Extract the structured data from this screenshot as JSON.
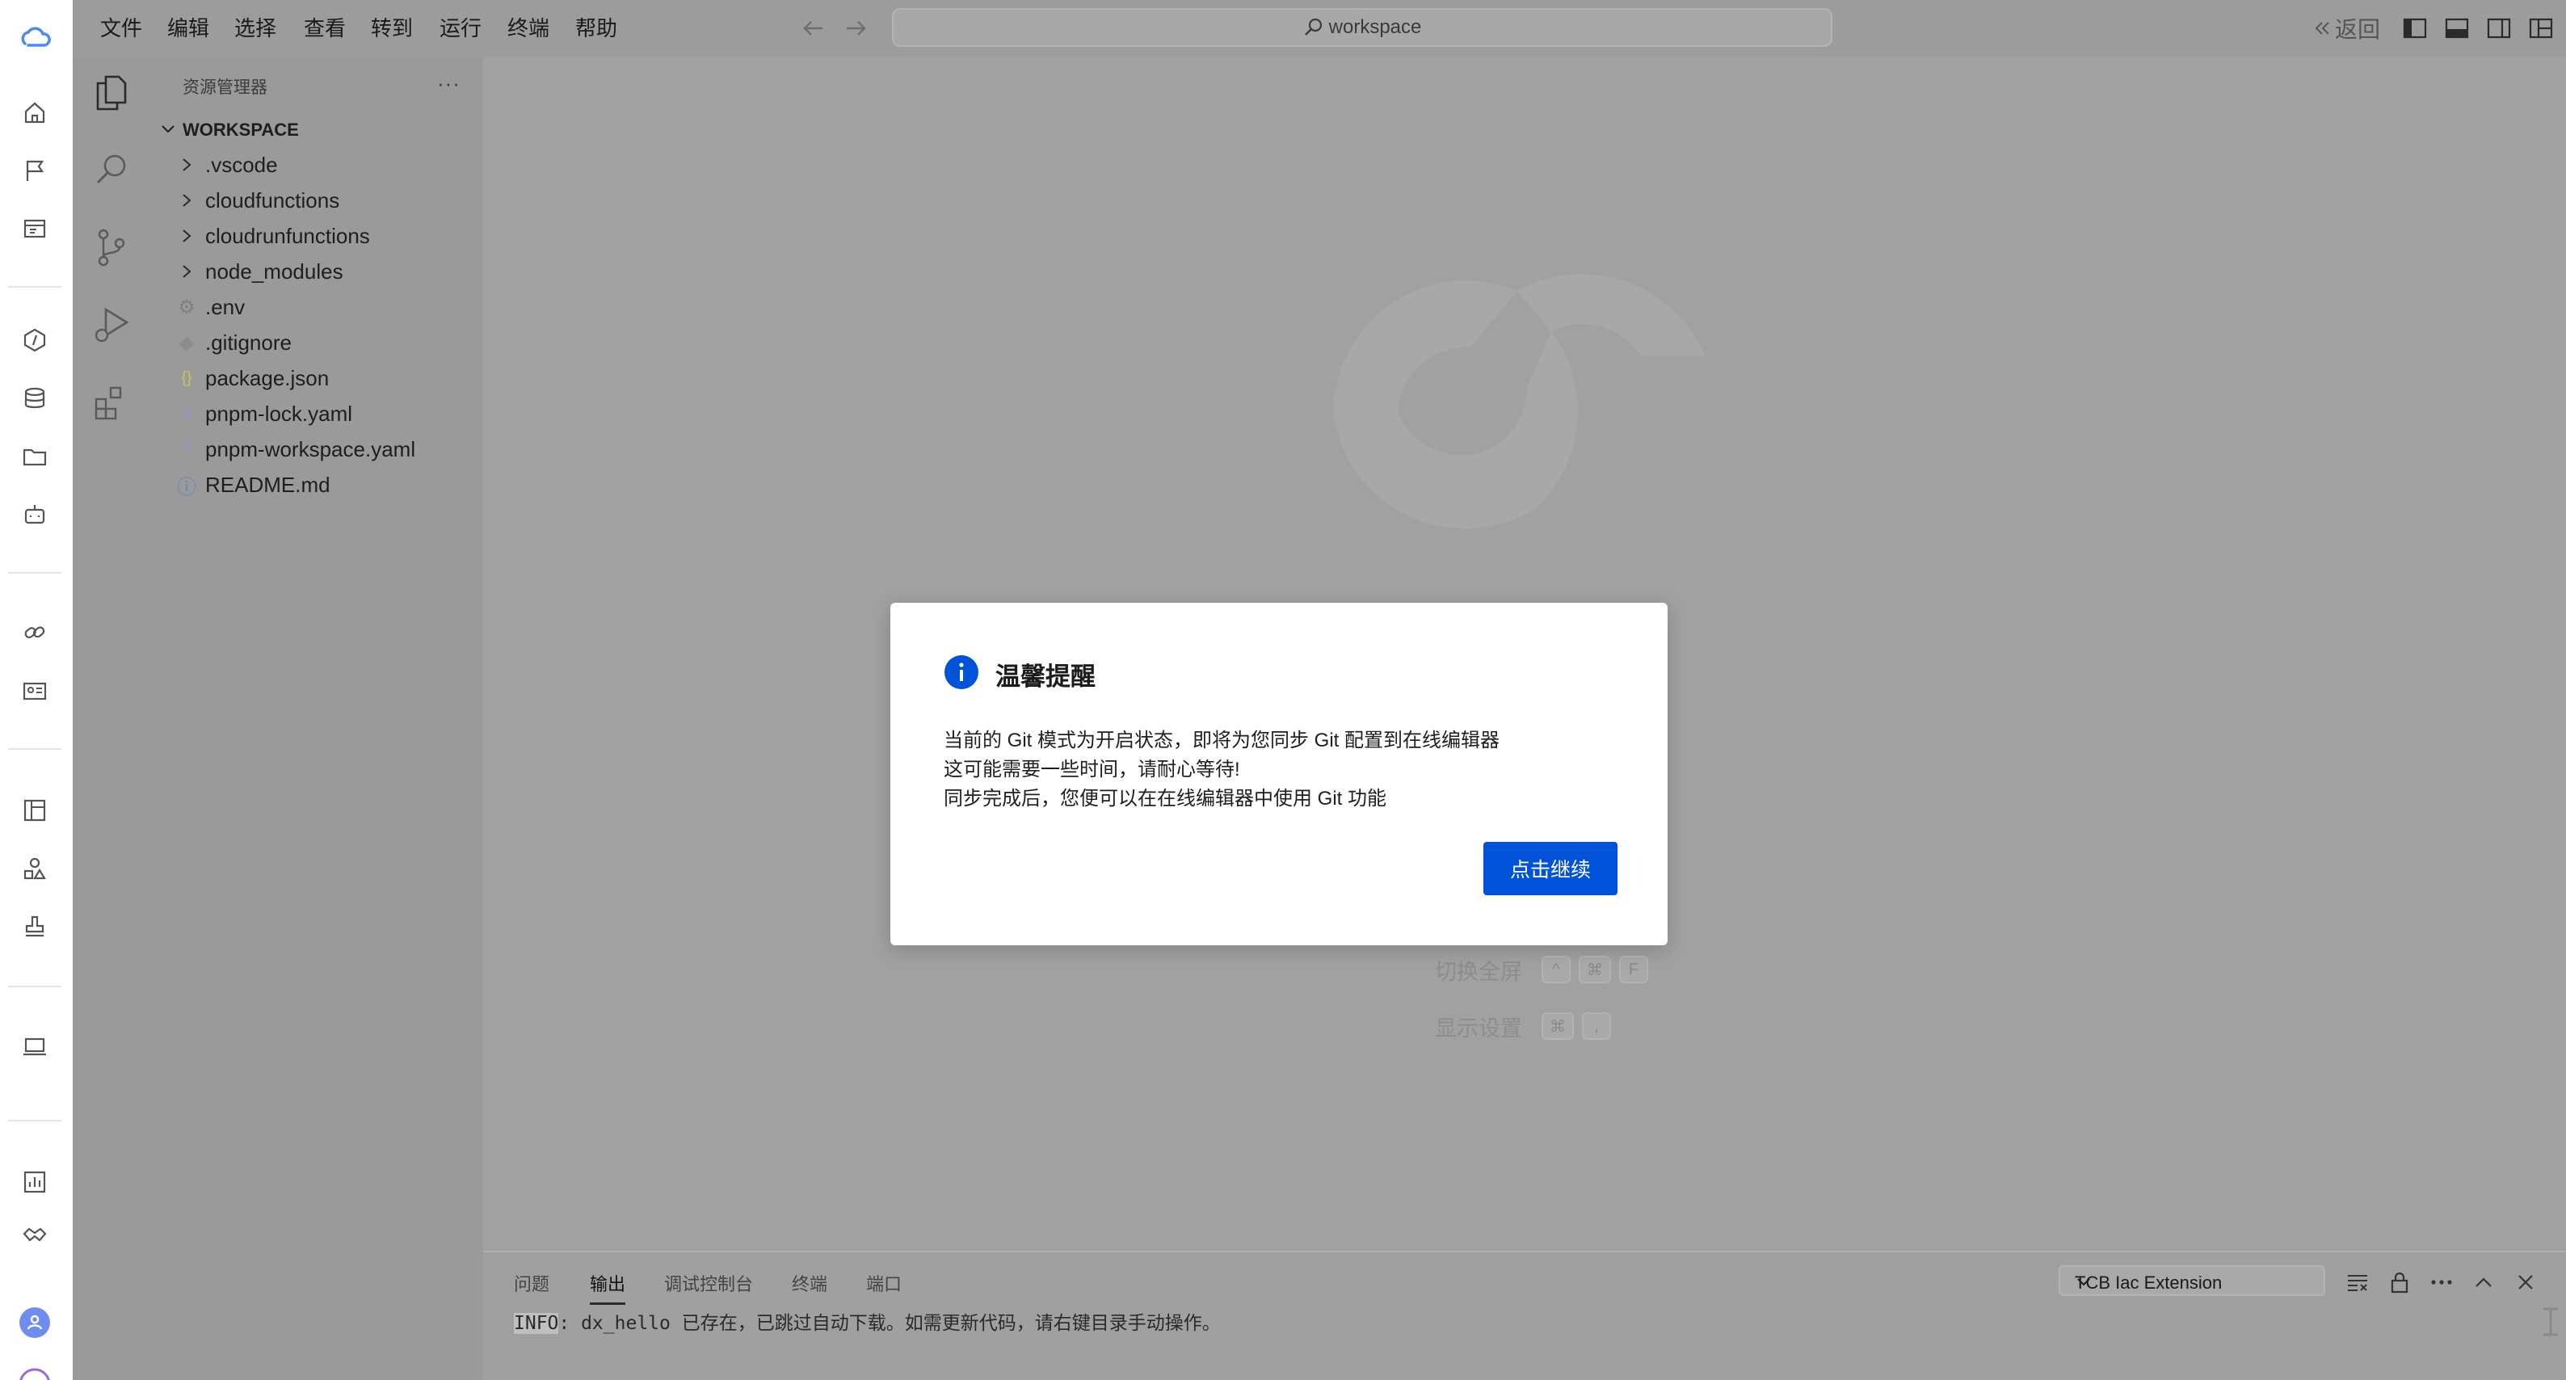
{
  "menu": [
    "文件",
    "编辑",
    "选择",
    "查看",
    "转到",
    "运行",
    "终端",
    "帮助"
  ],
  "search": {
    "text": "workspace"
  },
  "titlebar_right": {
    "back_label": "返回"
  },
  "explorer": {
    "title": "资源管理器",
    "more": "···",
    "workspace_label": "WORKSPACE",
    "items": [
      {
        "name": ".vscode",
        "type": "folder",
        "icon": "chevron-right-icon"
      },
      {
        "name": "cloudfunctions",
        "type": "folder",
        "icon": "chevron-right-icon"
      },
      {
        "name": "cloudrunfunctions",
        "type": "folder",
        "icon": "chevron-right-icon"
      },
      {
        "name": "node_modules",
        "type": "folder",
        "icon": "chevron-right-icon"
      },
      {
        "name": ".env",
        "type": "file",
        "icon": "gear-file-icon",
        "glyph": "⚙",
        "color": "#808080"
      },
      {
        "name": ".gitignore",
        "type": "file",
        "icon": "git-file-icon",
        "glyph": "◆",
        "color": "#8c8c8c"
      },
      {
        "name": "package.json",
        "type": "file",
        "icon": "json-file-icon",
        "glyph": "{}",
        "color": "#c9c25a"
      },
      {
        "name": "pnpm-lock.yaml",
        "type": "file",
        "icon": "yaml-file-icon",
        "glyph": "!",
        "color": "#9b8fd6"
      },
      {
        "name": "pnpm-workspace.yaml",
        "type": "file",
        "icon": "yaml-file-icon",
        "glyph": "!",
        "color": "#9b8fd6"
      },
      {
        "name": "README.md",
        "type": "file",
        "icon": "info-file-icon",
        "glyph": "ⓘ",
        "color": "#5f86b8"
      }
    ]
  },
  "editor_hints": [
    {
      "label": "切换全屏",
      "keys": [
        "^",
        "⌘",
        "F"
      ]
    },
    {
      "label": "显示设置",
      "keys": [
        "⌘",
        ","
      ]
    }
  ],
  "panel": {
    "tabs": [
      "问题",
      "输出",
      "调试控制台",
      "终端",
      "端口"
    ],
    "active_tab": "输出",
    "output_channel": "TCB Iac Extension",
    "log_prefix": "INFO",
    "log_rest": ": dx_hello 已存在，已跳过自动下载。如需更新代码，请右键目录手动操作。"
  },
  "modal": {
    "title": "温馨提醒",
    "lines": [
      "当前的 Git 模式为开启状态，即将为您同步 Git 配置到在线编辑器",
      "这可能需要一些时间，请耐心等待!",
      "同步完成后，您便可以在在线编辑器中使用 Git 功能"
    ],
    "button": "点击继续",
    "accent": "#0052d9"
  },
  "colors": {
    "overlay_gray": "#9f9f9f",
    "rail_bg": "#ffffff",
    "primary_blue": "#0052d9"
  }
}
